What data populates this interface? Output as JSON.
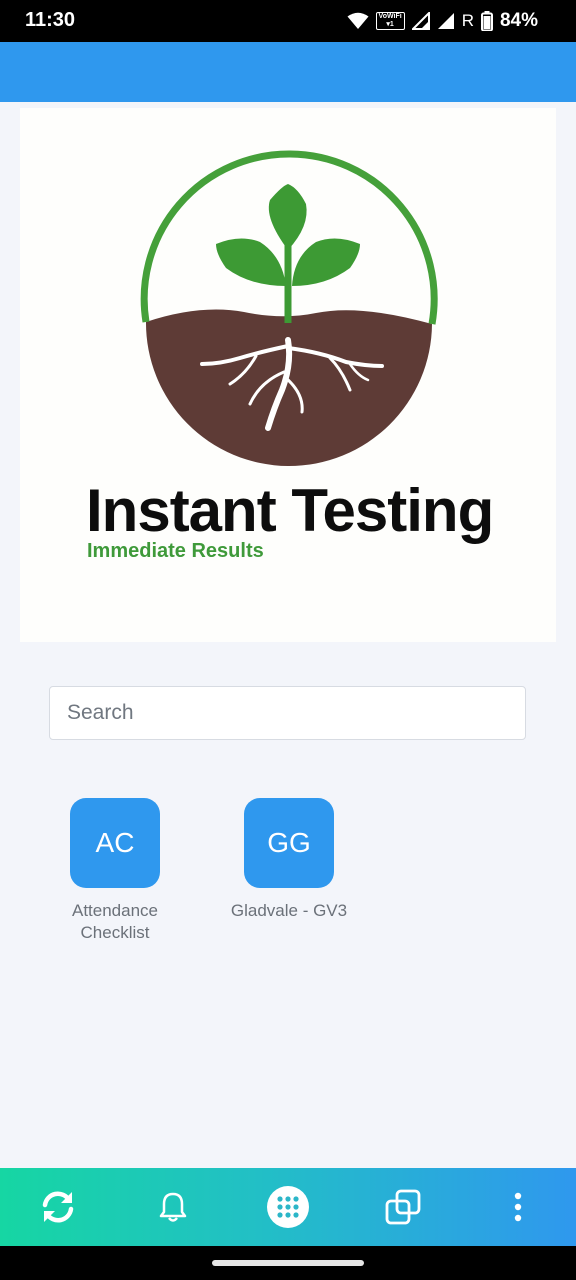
{
  "status_bar": {
    "time": "11:30",
    "vowifi_label": "VoWiFi",
    "roaming_indicator": "R",
    "battery_percent": "84%"
  },
  "logo": {
    "title": "Instant Testing",
    "subtitle": "Immediate Results",
    "colors": {
      "ring": "#45a03a",
      "leaf": "#3d9a34",
      "soil": "#5e3b36",
      "roots": "#ffffff"
    }
  },
  "search": {
    "placeholder": "Search",
    "value": ""
  },
  "apps": [
    {
      "initials": "AC",
      "label_line1": "Attendance",
      "label_line2": "Checklist"
    },
    {
      "initials": "GG",
      "label_line1": "Gladvale - GV3",
      "label_line2": ""
    }
  ],
  "bottom_nav": {
    "items": [
      {
        "icon": "sync-icon"
      },
      {
        "icon": "bell-icon"
      },
      {
        "icon": "apps-grid-icon"
      },
      {
        "icon": "copy-icon"
      },
      {
        "icon": "more-vertical-icon"
      }
    ]
  },
  "colors": {
    "accent": "#2f98ee",
    "background": "#f3f5fa",
    "nav_gradient_start": "#16d6a3",
    "nav_gradient_end": "#2f98ee"
  }
}
